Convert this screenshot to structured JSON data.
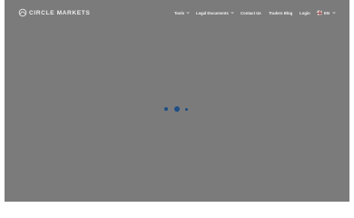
{
  "brand": {
    "name": "CIRCLE MARKETS",
    "logo_icon": "circle-markets-logo-icon"
  },
  "nav": {
    "tools_label": "Tools",
    "legal_label": "Legal Documents",
    "contact_label": "Contact Us",
    "blog_label": "Traders Blog",
    "login_label": "Login",
    "language_label": "EN",
    "flag_icon": "uk-flag-icon",
    "dropdown_icon": "chevron-down-icon"
  },
  "loader": {
    "icon": "loading-dots-icon",
    "color": "#1e4e86"
  },
  "colors": {
    "overlay": "#7b7b7b",
    "nav_text": "#f2f2f2"
  }
}
